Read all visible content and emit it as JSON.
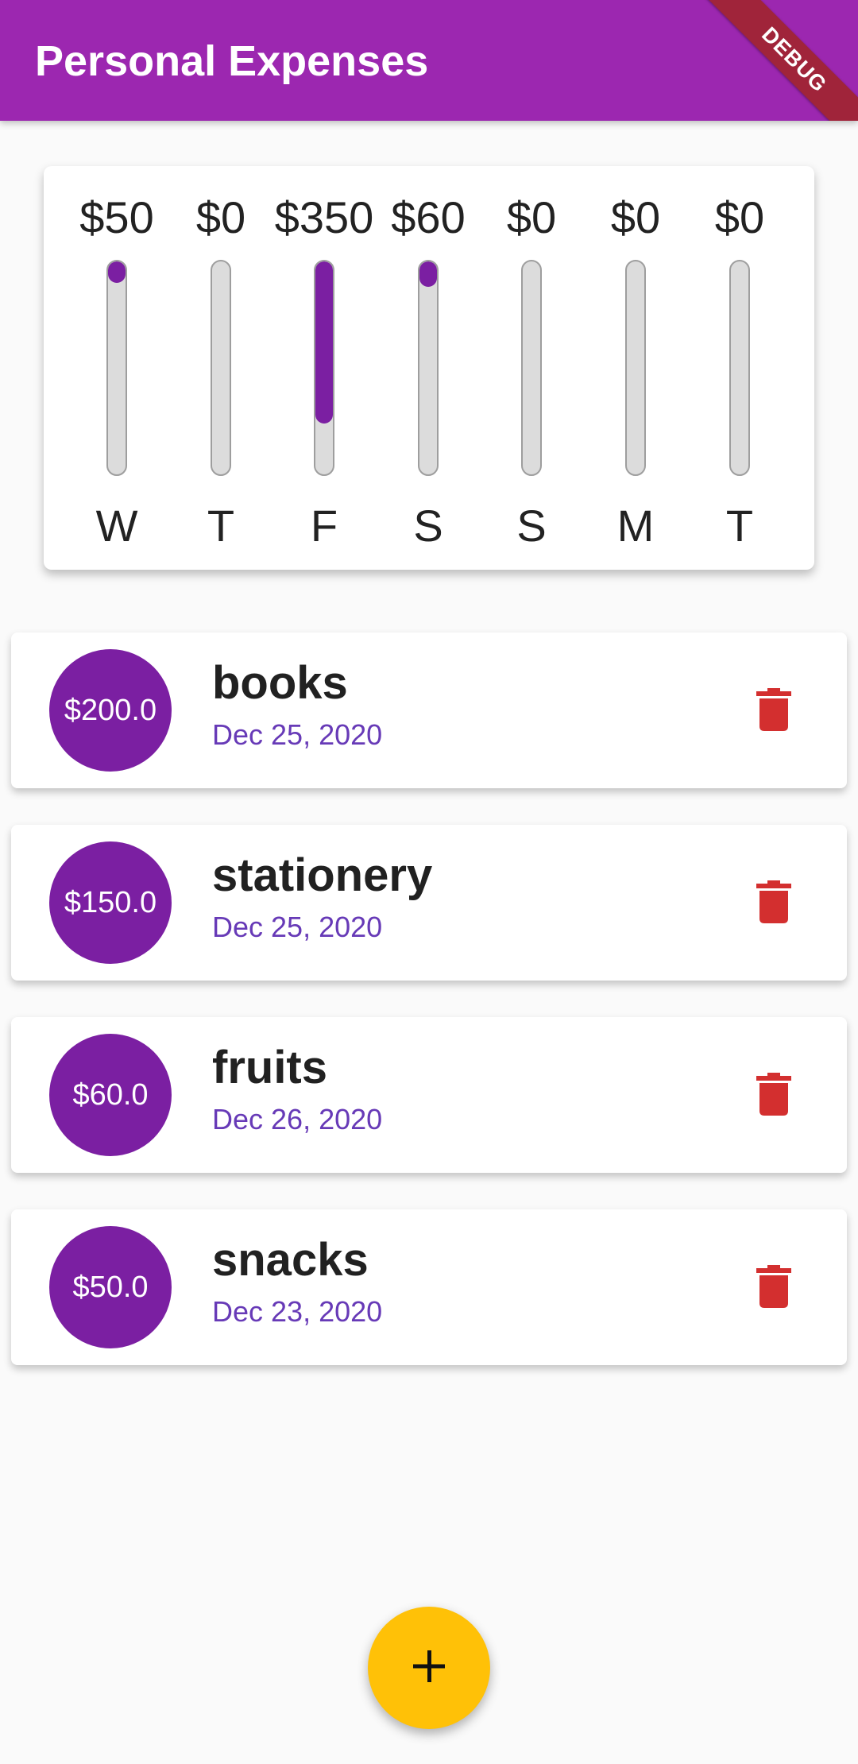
{
  "app": {
    "title": "Personal Expenses",
    "debug_label": "DEBUG",
    "add_icon": "add-icon",
    "primary_color": "#9c27b0",
    "accent_color": "#ffc107"
  },
  "chart": {
    "bars": [
      {
        "day": "W",
        "amount": "$50",
        "fraction": 0.1
      },
      {
        "day": "T",
        "amount": "$0",
        "fraction": 0
      },
      {
        "day": "F",
        "amount": "$350",
        "fraction": 0.76
      },
      {
        "day": "S",
        "amount": "$60",
        "fraction": 0.12
      },
      {
        "day": "S",
        "amount": "$0",
        "fraction": 0
      },
      {
        "day": "M",
        "amount": "$0",
        "fraction": 0
      },
      {
        "day": "T",
        "amount": "$0",
        "fraction": 0
      }
    ]
  },
  "transactions": [
    {
      "amount": "$200.0",
      "title": "books",
      "date": "Dec 25, 2020"
    },
    {
      "amount": "$150.0",
      "title": "stationery",
      "date": "Dec 25, 2020"
    },
    {
      "amount": "$60.0",
      "title": "fruits",
      "date": "Dec 26, 2020"
    },
    {
      "amount": "$50.0",
      "title": "snacks",
      "date": "Dec 23, 2020"
    }
  ],
  "fab": {
    "icon": "add-icon",
    "label": "+"
  },
  "delete_color": "#d32f2f"
}
